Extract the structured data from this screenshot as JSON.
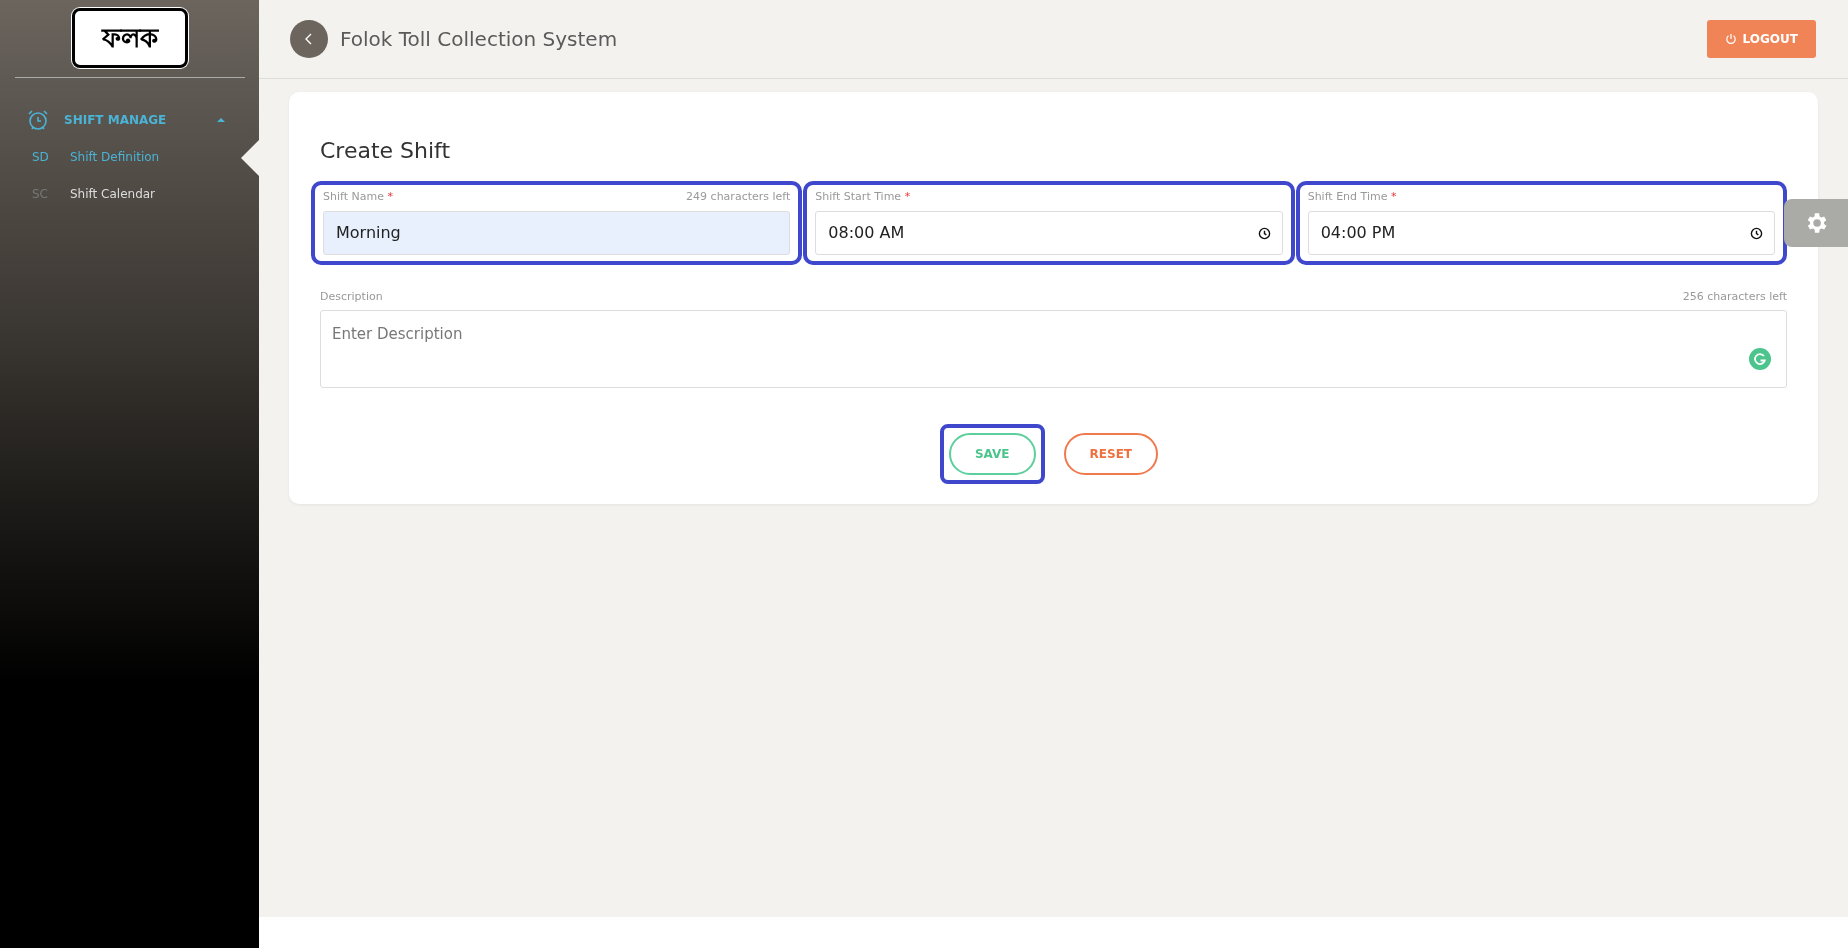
{
  "sidebar": {
    "logo": "ফলক",
    "groups": [
      {
        "label": "SHIFT MANAGE",
        "expanded": true,
        "items": [
          {
            "abbr": "SD",
            "label": "Shift Definition",
            "selected": true
          },
          {
            "abbr": "SC",
            "label": "Shift Calendar",
            "selected": false
          }
        ]
      }
    ]
  },
  "header": {
    "title": "Folok Toll Collection System",
    "logout": "LOGOUT"
  },
  "form": {
    "title": "Create Shift",
    "fields": [
      {
        "kind": "text",
        "label": "Shift Name",
        "required_mark": "*",
        "counter": "249 characters left",
        "value": "Morning",
        "highlighted": true
      },
      {
        "kind": "time",
        "label": "Shift Start Time",
        "required_mark": "*",
        "value": "08:00 AM",
        "highlighted": true
      },
      {
        "kind": "time",
        "label": "Shift End Time",
        "required_mark": "*",
        "value": "04:00 PM",
        "highlighted": true
      }
    ],
    "description": {
      "label": "Description",
      "counter": "256 characters left",
      "placeholder": "Enter Description"
    },
    "buttons": [
      {
        "kind": "save",
        "label": "SAVE",
        "highlighted": true
      },
      {
        "kind": "reset",
        "label": "RESET",
        "highlighted": false
      }
    ]
  }
}
